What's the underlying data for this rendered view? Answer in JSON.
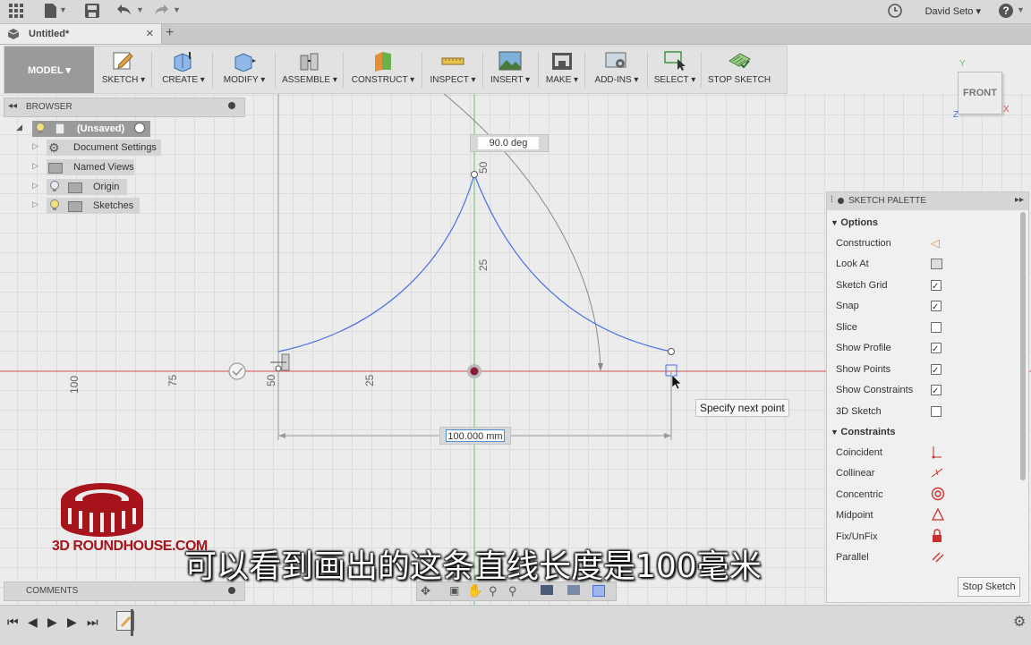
{
  "topbar": {
    "user": "David Seto ▾",
    "help": "?"
  },
  "tab": {
    "title": "Untitled*",
    "close": "×",
    "new": "+"
  },
  "toolbar": {
    "model": "MODEL ▾",
    "tools": [
      "SKETCH ▾",
      "CREATE ▾",
      "MODIFY ▾",
      "ASSEMBLE ▾",
      "CONSTRUCT ▾",
      "INSPECT ▾",
      "INSERT ▾",
      "MAKE ▾",
      "ADD-INS ▾",
      "SELECT ▾",
      "STOP SKETCH"
    ]
  },
  "browser": {
    "title": "BROWSER",
    "root": "(Unsaved)",
    "items": [
      "Document Settings",
      "Named Views",
      "Origin",
      "Sketches"
    ]
  },
  "comments": {
    "title": "COMMENTS"
  },
  "canvas": {
    "angle": "90.0 deg",
    "length": "100.000 mm",
    "tooltip": "Specify next point",
    "ruler_h": [
      "100",
      "75",
      "50",
      "25"
    ],
    "ruler_v": [
      "50",
      "25"
    ]
  },
  "viewcube": {
    "face": "FRONT",
    "x": "X",
    "y": "Y",
    "z": "Z"
  },
  "palette": {
    "title": "SKETCH PALETTE",
    "options_title": "Options",
    "options": [
      {
        "label": "Construction"
      },
      {
        "label": "Look At"
      },
      {
        "label": "Sketch Grid",
        "checked": true
      },
      {
        "label": "Snap",
        "checked": true
      },
      {
        "label": "Slice",
        "checked": false
      },
      {
        "label": "Show Profile",
        "checked": true
      },
      {
        "label": "Show Points",
        "checked": true
      },
      {
        "label": "Show Constraints",
        "checked": true
      },
      {
        "label": "3D Sketch",
        "checked": false
      }
    ],
    "constraints_title": "Constraints",
    "constraints": [
      "Coincident",
      "Collinear",
      "Concentric",
      "Midpoint",
      "Fix/UnFix",
      "Parallel"
    ],
    "stop_button": "Stop Sketch"
  },
  "logo": {
    "text": "3D ROUNDHOUSE.COM"
  },
  "subtitle": "可以看到画出的这条直线长度是100毫米",
  "colors": {
    "accent_blue": "#4a6fe3",
    "axis_red": "#d9534f",
    "axis_green": "#6ac46a",
    "logo_red": "#a8141b"
  }
}
